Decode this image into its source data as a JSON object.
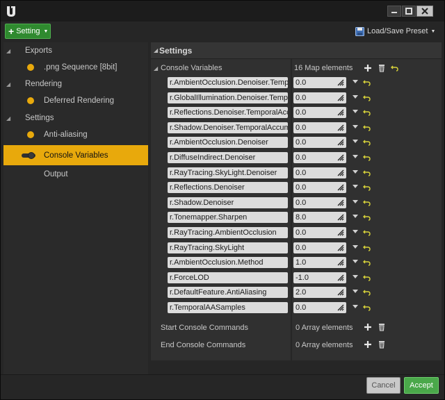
{
  "titlebar": {
    "logo_icon": "unreal-logo-icon",
    "controls": [
      "minimize-icon",
      "maximize-icon",
      "close-icon"
    ]
  },
  "toolbar": {
    "setting_label": "Setting",
    "preset_label": "Load/Save Preset",
    "preset_icon": "floppy-disk-icon"
  },
  "sidebar": {
    "groups": [
      {
        "label": "Exports",
        "items": [
          ".png Sequence [8bit]"
        ]
      },
      {
        "label": "Rendering",
        "items": [
          "Deferred Rendering"
        ]
      },
      {
        "label": "Settings",
        "items": [
          "Anti-aliasing",
          "Console Variables",
          "Output"
        ]
      }
    ],
    "selected": "Console Variables"
  },
  "settings": {
    "header": "Settings",
    "console_variables": {
      "label": "Console Variables",
      "count": "16 Map elements",
      "entries": [
        {
          "key": "r.AmbientOcclusion.Denoiser.TemporalAccumulation",
          "value": "0.0"
        },
        {
          "key": "r.GlobalIllumination.Denoiser.TemporalAccumulation",
          "value": "0.0"
        },
        {
          "key": "r.Reflections.Denoiser.TemporalAccumulation",
          "value": "0.0"
        },
        {
          "key": "r.Shadow.Denoiser.TemporalAccumulation",
          "value": "0.0"
        },
        {
          "key": "r.AmbientOcclusion.Denoiser",
          "value": "0.0"
        },
        {
          "key": "r.DiffuseIndirect.Denoiser",
          "value": "0.0"
        },
        {
          "key": "r.RayTracing.SkyLight.Denoiser",
          "value": "0.0"
        },
        {
          "key": "r.Reflections.Denoiser",
          "value": "0.0"
        },
        {
          "key": "r.Shadow.Denoiser",
          "value": "0.0"
        },
        {
          "key": "r.Tonemapper.Sharpen",
          "value": "8.0"
        },
        {
          "key": "r.RayTracing.AmbientOcclusion",
          "value": "0.0"
        },
        {
          "key": "r.RayTracing.SkyLight",
          "value": "0.0"
        },
        {
          "key": "r.AmbientOcclusion.Method",
          "value": "1.0"
        },
        {
          "key": "r.ForceLOD",
          "value": "-1.0"
        },
        {
          "key": "r.DefaultFeature.AntiAliasing",
          "value": "2.0"
        },
        {
          "key": "r.TemporalAASamples",
          "value": "0.0"
        }
      ]
    },
    "start_console_commands": {
      "label": "Start Console Commands",
      "count": "0 Array elements"
    },
    "end_console_commands": {
      "label": "End Console Commands",
      "count": "0 Array elements"
    }
  },
  "footer": {
    "cancel_label": "Cancel",
    "accept_label": "Accept"
  },
  "colors": {
    "accent": "#e8a90c",
    "accept": "#4aa84a",
    "setting_button": "#2f8a2f"
  }
}
